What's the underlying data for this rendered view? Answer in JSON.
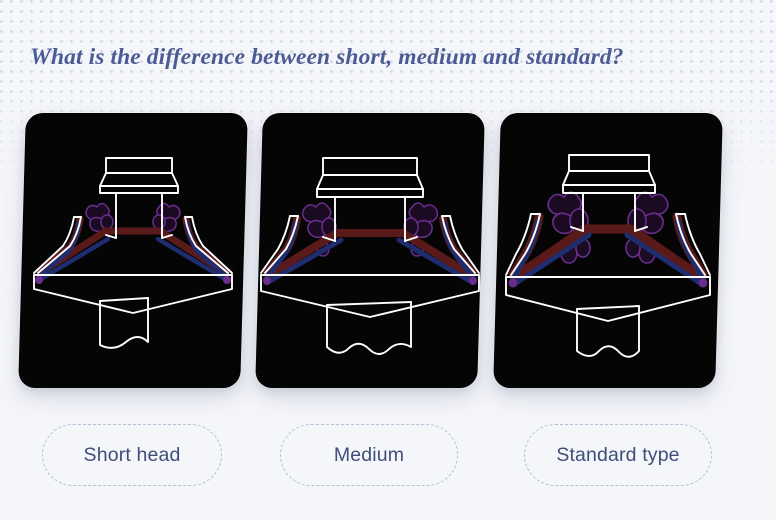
{
  "page": {
    "title": "What is the difference between short, medium and standard?",
    "background_color": "#f5f6fa",
    "dot_color": "#ccd2e8",
    "title_color": "#4a5c93"
  },
  "cards": [
    {
      "id": "card-short-head",
      "background_color": "#050505",
      "illustration": "line-art-anatomical-column-short",
      "variant": "short",
      "outline_color": "#ffffff",
      "accent_red": "#5a1a1a",
      "accent_blue": "#1f2c6e",
      "accent_purple": "#6b2d8c"
    },
    {
      "id": "card-medium",
      "background_color": "#050505",
      "illustration": "line-art-anatomical-column-medium",
      "variant": "medium",
      "outline_color": "#ffffff",
      "accent_red": "#5a1a1a",
      "accent_blue": "#1f2c6e",
      "accent_purple": "#6b2d8c"
    },
    {
      "id": "card-standard-type",
      "background_color": "#050505",
      "illustration": "line-art-anatomical-column-standard",
      "variant": "standard",
      "outline_color": "#ffffff",
      "accent_red": "#5a1a1a",
      "accent_blue": "#1f2c6e",
      "accent_purple": "#6b2d8c"
    }
  ],
  "buttons": [
    {
      "label": "Short head",
      "name": "option-short-head"
    },
    {
      "label": "Medium",
      "name": "option-medium"
    },
    {
      "label": "Standard type",
      "name": "option-standard-type"
    }
  ]
}
